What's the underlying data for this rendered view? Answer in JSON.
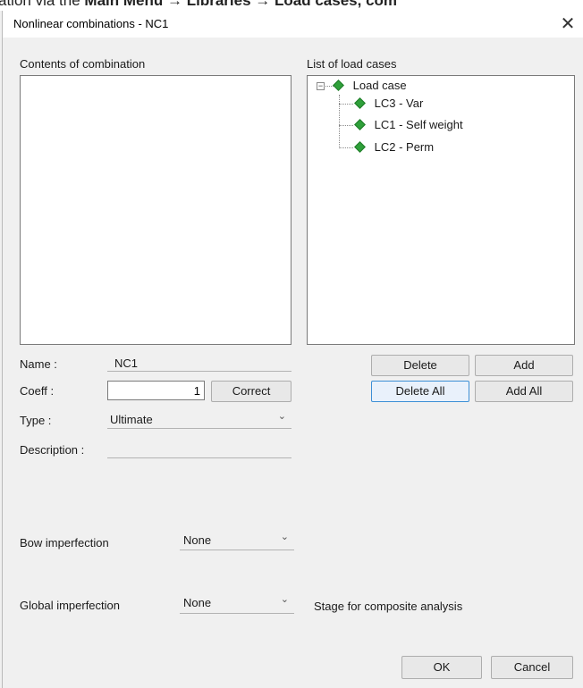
{
  "background_doc": {
    "fragment_1": "ation via the",
    "fragment_2": "Main Menu",
    "fragment_3": "→",
    "fragment_4": "Libraries",
    "fragment_5": "→",
    "fragment_6": "Load cases, com"
  },
  "dialog": {
    "title": "Nonlinear combinations - NC1",
    "close_glyph": "✕"
  },
  "contents": {
    "label": "Contents of combination"
  },
  "load_cases": {
    "label": "List of load cases",
    "root": "Load case",
    "items": [
      "LC3 - Var",
      "LC1 - Self weight",
      "LC2 - Perm"
    ],
    "icon": "green-diamond-icon",
    "icon_color": "#2fa03a"
  },
  "form": {
    "name_label": "Name :",
    "name_value": "NC1",
    "coeff_label": "Coeff :",
    "coeff_value": "1",
    "correct_button": "Correct",
    "type_label": "Type :",
    "type_value": "Ultimate",
    "description_label": "Description :",
    "description_value": ""
  },
  "list_buttons": {
    "delete": "Delete",
    "add": "Add",
    "delete_all": "Delete All",
    "add_all": "Add All"
  },
  "imperfections": {
    "bow_label": "Bow imperfection",
    "bow_value": "None",
    "global_label": "Global imperfection",
    "global_value": "None",
    "stage_label": "Stage for composite analysis"
  },
  "footer": {
    "ok": "OK",
    "cancel": "Cancel"
  },
  "dropdown_glyph": "⌄"
}
